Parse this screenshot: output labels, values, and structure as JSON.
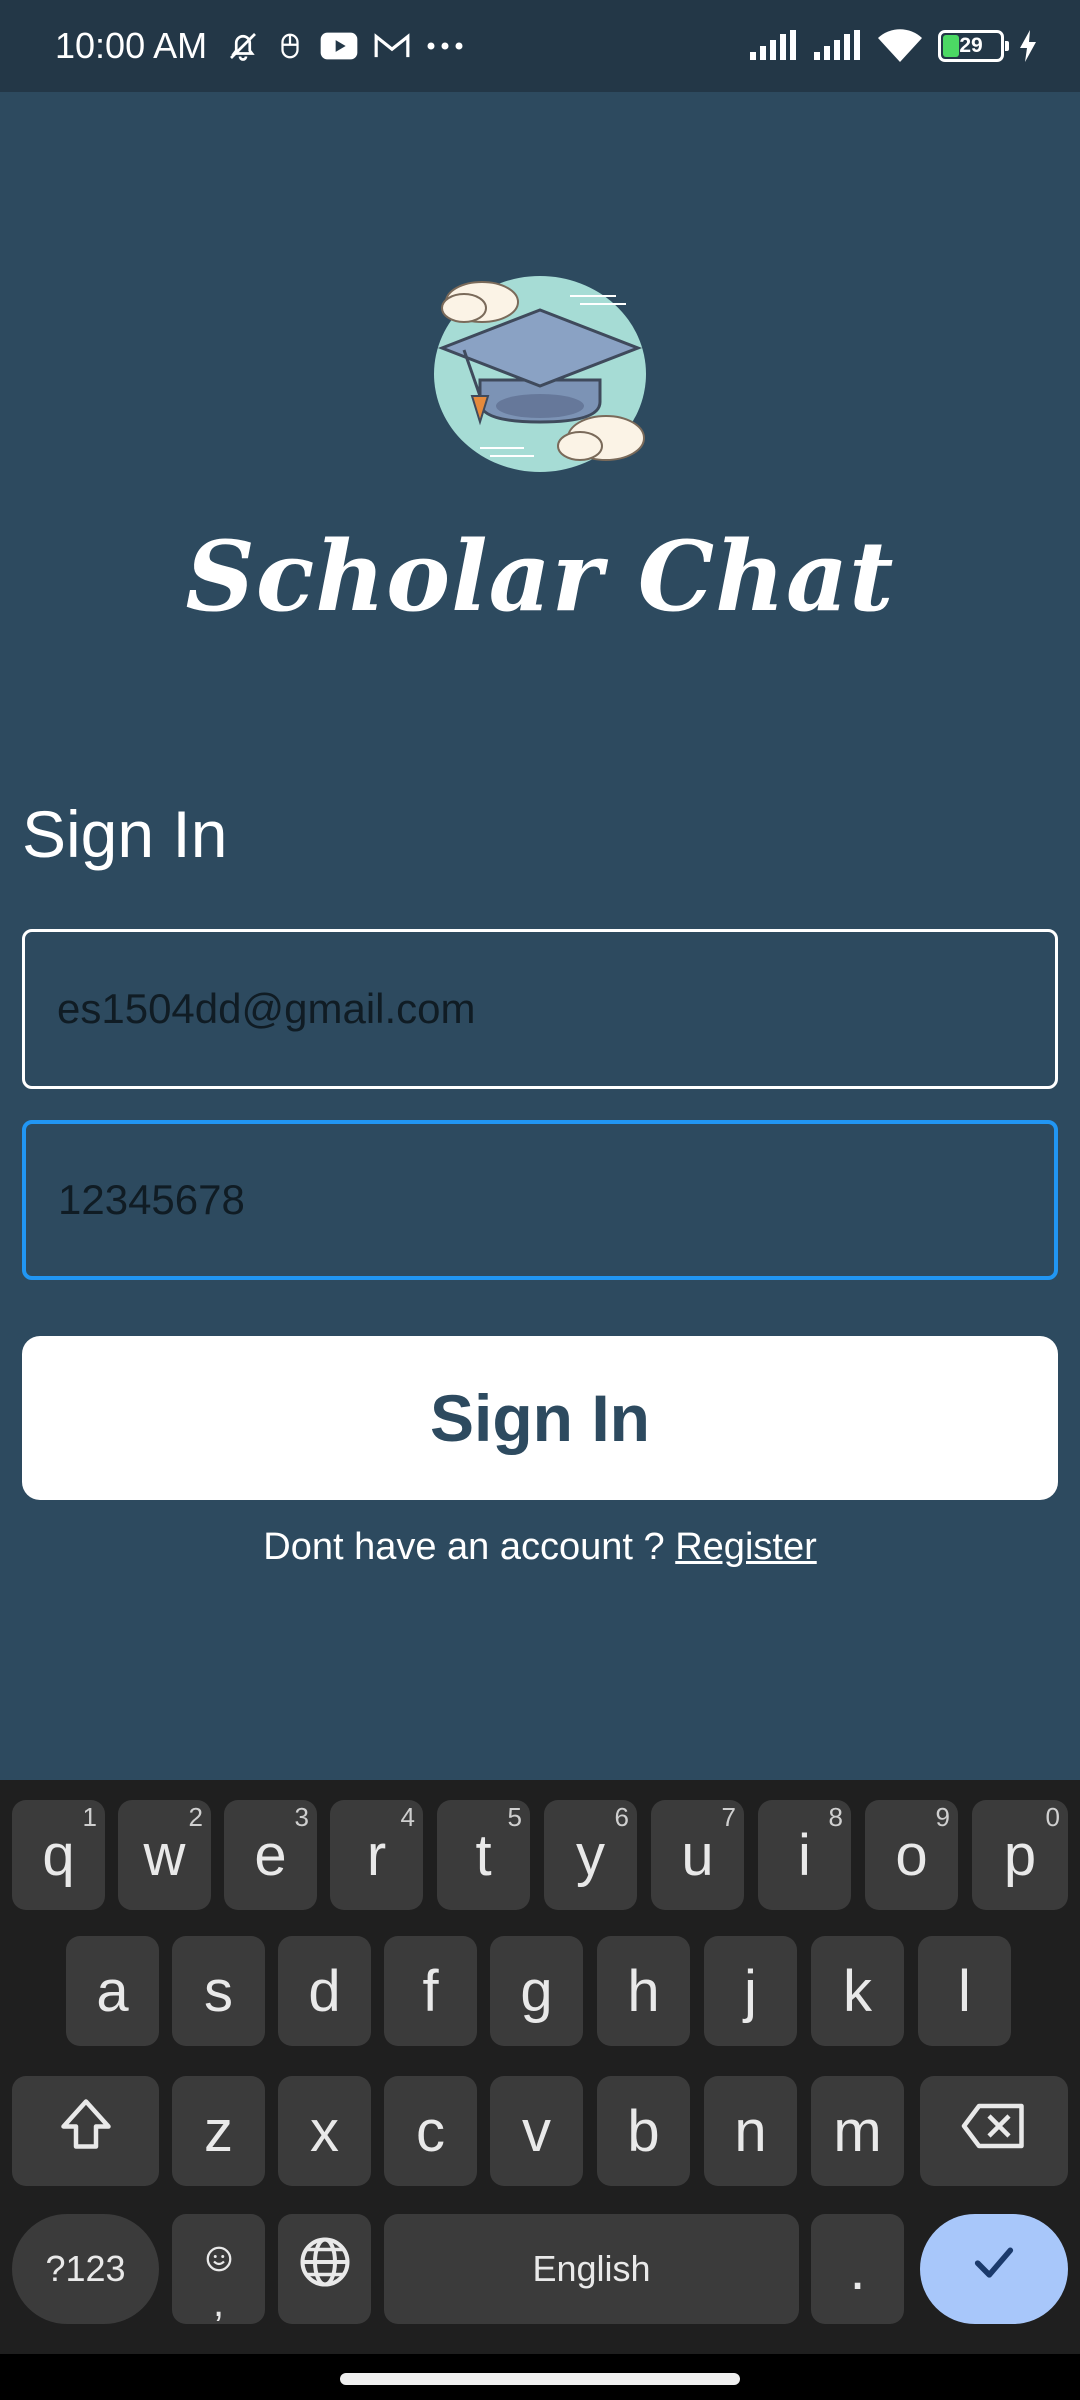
{
  "status_bar": {
    "time": "10:00 AM",
    "battery_level": "29",
    "battery_fraction": 0.29,
    "icons_left": [
      "bell-off-icon",
      "mouse-icon",
      "youtube-icon",
      "gmail-icon",
      "more-icon"
    ],
    "icons_right": [
      "signal-icon",
      "signal-icon",
      "wifi-icon",
      "battery-icon",
      "charging-icon"
    ]
  },
  "app": {
    "title": "Scholar Chat",
    "logo_icon": "graduation-cap-icon"
  },
  "form": {
    "heading": "Sign In",
    "email_value": "es1504dd@gmail.com",
    "password_value": "12345678",
    "submit_label": "Sign In",
    "register_prompt": "Dont  have an account ?",
    "register_link": "Register"
  },
  "keyboard": {
    "row1": [
      {
        "key": "q",
        "hint": "1"
      },
      {
        "key": "w",
        "hint": "2"
      },
      {
        "key": "e",
        "hint": "3"
      },
      {
        "key": "r",
        "hint": "4"
      },
      {
        "key": "t",
        "hint": "5"
      },
      {
        "key": "y",
        "hint": "6"
      },
      {
        "key": "u",
        "hint": "7"
      },
      {
        "key": "i",
        "hint": "8"
      },
      {
        "key": "o",
        "hint": "9"
      },
      {
        "key": "p",
        "hint": "0"
      }
    ],
    "row2": [
      "a",
      "s",
      "d",
      "f",
      "g",
      "h",
      "j",
      "k",
      "l"
    ],
    "row3": [
      "z",
      "x",
      "c",
      "v",
      "b",
      "n",
      "m"
    ],
    "symbols_label": "?123",
    "comma_label": ",",
    "space_label": "English",
    "period_label": ".",
    "colors": {
      "background": "#1f1f1f",
      "key": "#3b3b3b",
      "enter": "#a8c7fa"
    }
  },
  "colors": {
    "background": "#2d4a5f",
    "status_bar": "#233747",
    "focus_border": "#2196f3",
    "button_bg": "#ffffff",
    "button_text": "#2d4a5f"
  }
}
